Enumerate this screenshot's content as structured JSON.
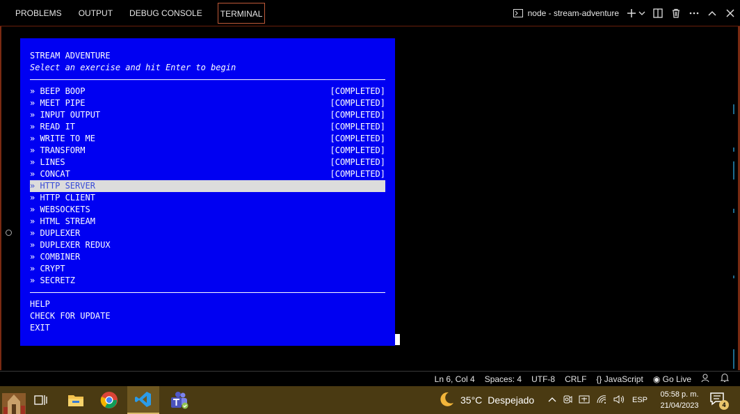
{
  "panel": {
    "tabs": [
      "PROBLEMS",
      "OUTPUT",
      "DEBUG CONSOLE",
      "TERMINAL"
    ],
    "terminal_name": "node - stream-adventure"
  },
  "tui": {
    "title": "STREAM ADVENTURE",
    "subtitle": "Select an exercise and hit Enter to begin",
    "exercises": [
      {
        "label": "» BEEP BOOP",
        "status": "[COMPLETED]"
      },
      {
        "label": "» MEET PIPE",
        "status": "[COMPLETED]"
      },
      {
        "label": "» INPUT OUTPUT",
        "status": "[COMPLETED]"
      },
      {
        "label": "» READ IT",
        "status": "[COMPLETED]"
      },
      {
        "label": "» WRITE TO ME",
        "status": "[COMPLETED]"
      },
      {
        "label": "» TRANSFORM",
        "status": "[COMPLETED]"
      },
      {
        "label": "» LINES",
        "status": "[COMPLETED]"
      },
      {
        "label": "» CONCAT",
        "status": "[COMPLETED]"
      },
      {
        "label": "» HTTP SERVER",
        "status": ""
      },
      {
        "label": "» HTTP CLIENT",
        "status": ""
      },
      {
        "label": "» WEBSOCKETS",
        "status": ""
      },
      {
        "label": "» HTML STREAM",
        "status": ""
      },
      {
        "label": "» DUPLEXER",
        "status": ""
      },
      {
        "label": "» DUPLEXER REDUX",
        "status": ""
      },
      {
        "label": "» COMBINER",
        "status": ""
      },
      {
        "label": "» CRYPT",
        "status": ""
      },
      {
        "label": "» SECRETZ",
        "status": ""
      }
    ],
    "selected_index": 8,
    "footer": [
      "HELP",
      "CHECK FOR UPDATE",
      "EXIT"
    ]
  },
  "statusbar": {
    "position": "Ln 6, Col 4",
    "spaces": "Spaces: 4",
    "encoding": "UTF-8",
    "eol": "CRLF",
    "language": "JavaScript",
    "golive": "Go Live"
  },
  "taskbar": {
    "temperature": "35°C",
    "weather": "Despejado",
    "language": "ESP",
    "time": "05:58 p. m.",
    "date": "21/04/2023",
    "notifications": "4"
  },
  "colors": {
    "terminal_bg": "#0000f2",
    "selected_bg": "#dcdcdc",
    "accent": "#c05a38",
    "taskbar": "#4a3a12"
  }
}
